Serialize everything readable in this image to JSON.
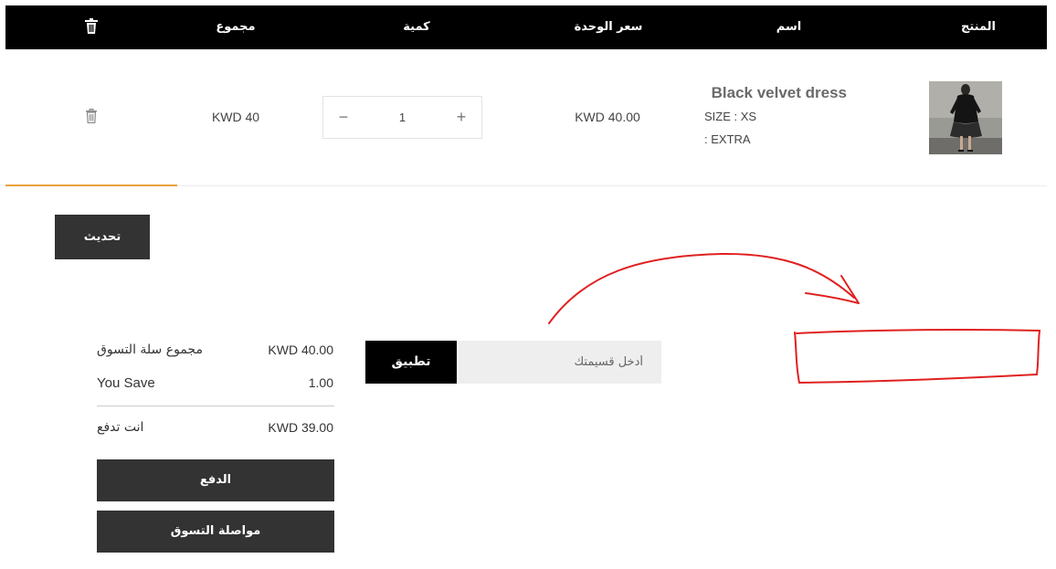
{
  "header": {
    "product": "المنتج",
    "name": "اسم",
    "unit_price": "سعر الوحدة",
    "quantity": "كمية",
    "total": "مجموع"
  },
  "item": {
    "name": "Black velvet dress",
    "size": "SIZE : XS",
    "extra": ": EXTRA",
    "unit_price": "KWD 40.00",
    "quantity": "1",
    "total": "KWD 40",
    "minus": "−",
    "plus": "+"
  },
  "actions": {
    "update": "تحديث"
  },
  "coupon": {
    "placeholder": "أدخل قسيمتك",
    "apply": "تطبيق"
  },
  "summary": {
    "subtotal_label": "مجموع سلة التسوق",
    "subtotal_value": "KWD 40.00",
    "save_label": "You Save",
    "save_value": "1.00",
    "pay_label": "انت تدفع",
    "pay_value": "KWD 39.00",
    "checkout": "الدفع",
    "continue": "مواصلة التسوق"
  },
  "colors": {
    "header_bg": "#000000",
    "button_bg": "#333333",
    "accent_underline": "#e8a33a",
    "annotation": "#e02020"
  },
  "icons": {
    "header_delete": "trash-icon",
    "row_delete": "trash-icon"
  }
}
